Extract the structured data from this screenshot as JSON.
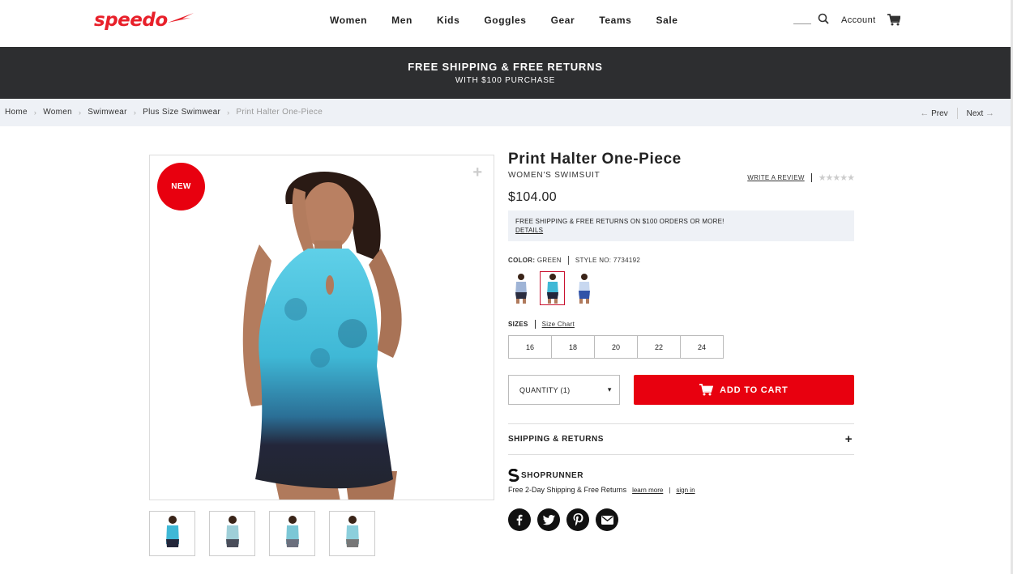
{
  "header": {
    "logo": "speedo",
    "nav": [
      "Women",
      "Men",
      "Kids",
      "Goggles",
      "Gear",
      "Teams",
      "Sale"
    ],
    "account_label": "Account"
  },
  "promo": {
    "title": "FREE SHIPPING & FREE RETURNS",
    "subtitle": "WITH $100 PURCHASE"
  },
  "breadcrumb": {
    "items": [
      "Home",
      "Women",
      "Swimwear",
      "Plus Size Swimwear"
    ],
    "current": "Print Halter One-Piece",
    "prev_label": "Prev",
    "next_label": "Next"
  },
  "gallery": {
    "badge": "NEW"
  },
  "product": {
    "title": "Print Halter One-Piece",
    "subtitle": "WOMEN'S SWIMSUIT",
    "write_review_label": "WRITE A REVIEW",
    "rating_stars": "★★★★★",
    "price": "$104.00",
    "shipping_note": "FREE SHIPPING & FREE RETURNS ON $100 ORDERS OR MORE!",
    "shipping_details_label": "DETAILS",
    "color_label": "COLOR:",
    "color_value": "GREEN",
    "style_label": "STYLE NO: 7734192",
    "sizes_label": "SIZES",
    "size_chart_label": "Size Chart",
    "sizes": [
      "16",
      "18",
      "20",
      "22",
      "24"
    ],
    "quantity_label": "QUANTITY (1)",
    "add_to_cart_label": "ADD TO CART",
    "shipping_returns_label": "SHIPPING & RETURNS",
    "expand_symbol": "+"
  },
  "shoprunner": {
    "brand": "SHOPRUNNER",
    "text": "Free 2-Day Shipping & Free Returns",
    "learn_more": "learn more",
    "separator": "|",
    "sign_in": "sign in"
  },
  "social": [
    "facebook-icon",
    "twitter-icon",
    "pinterest-icon",
    "email-icon"
  ],
  "colors": {
    "brand_red": "#e8000f",
    "promo_bg": "#2d2e30",
    "breadcrumb_bg": "#eef1f6"
  }
}
